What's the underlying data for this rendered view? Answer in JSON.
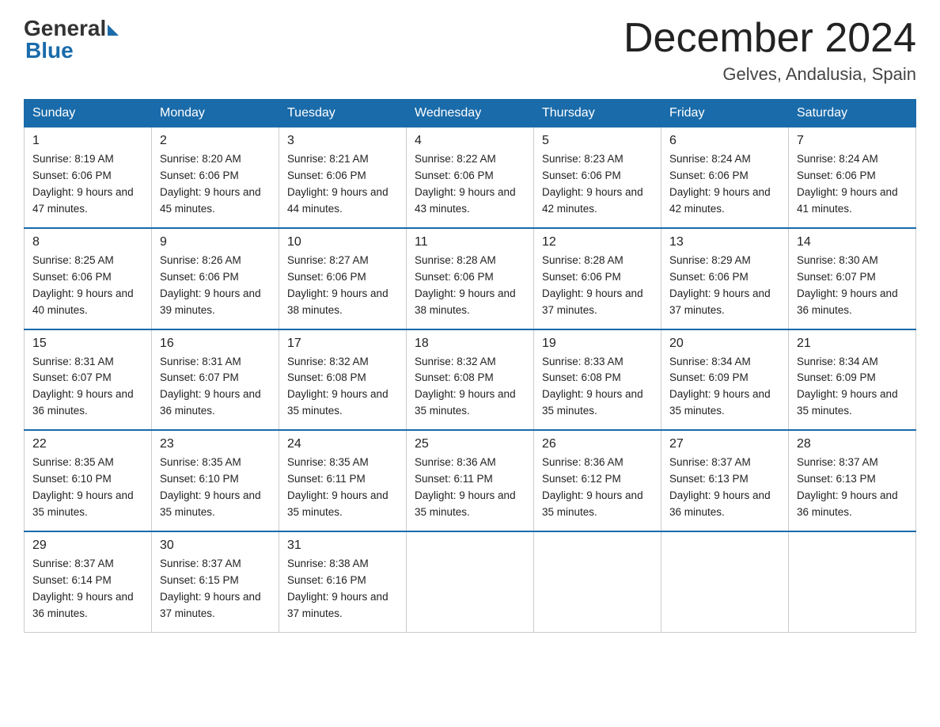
{
  "header": {
    "logo_general": "General",
    "logo_blue": "Blue",
    "month_title": "December 2024",
    "location": "Gelves, Andalusia, Spain"
  },
  "days_of_week": [
    "Sunday",
    "Monday",
    "Tuesday",
    "Wednesday",
    "Thursday",
    "Friday",
    "Saturday"
  ],
  "weeks": [
    [
      {
        "day": "1",
        "sunrise": "8:19 AM",
        "sunset": "6:06 PM",
        "daylight": "9 hours and 47 minutes."
      },
      {
        "day": "2",
        "sunrise": "8:20 AM",
        "sunset": "6:06 PM",
        "daylight": "9 hours and 45 minutes."
      },
      {
        "day": "3",
        "sunrise": "8:21 AM",
        "sunset": "6:06 PM",
        "daylight": "9 hours and 44 minutes."
      },
      {
        "day": "4",
        "sunrise": "8:22 AM",
        "sunset": "6:06 PM",
        "daylight": "9 hours and 43 minutes."
      },
      {
        "day": "5",
        "sunrise": "8:23 AM",
        "sunset": "6:06 PM",
        "daylight": "9 hours and 42 minutes."
      },
      {
        "day": "6",
        "sunrise": "8:24 AM",
        "sunset": "6:06 PM",
        "daylight": "9 hours and 42 minutes."
      },
      {
        "day": "7",
        "sunrise": "8:24 AM",
        "sunset": "6:06 PM",
        "daylight": "9 hours and 41 minutes."
      }
    ],
    [
      {
        "day": "8",
        "sunrise": "8:25 AM",
        "sunset": "6:06 PM",
        "daylight": "9 hours and 40 minutes."
      },
      {
        "day": "9",
        "sunrise": "8:26 AM",
        "sunset": "6:06 PM",
        "daylight": "9 hours and 39 minutes."
      },
      {
        "day": "10",
        "sunrise": "8:27 AM",
        "sunset": "6:06 PM",
        "daylight": "9 hours and 38 minutes."
      },
      {
        "day": "11",
        "sunrise": "8:28 AM",
        "sunset": "6:06 PM",
        "daylight": "9 hours and 38 minutes."
      },
      {
        "day": "12",
        "sunrise": "8:28 AM",
        "sunset": "6:06 PM",
        "daylight": "9 hours and 37 minutes."
      },
      {
        "day": "13",
        "sunrise": "8:29 AM",
        "sunset": "6:06 PM",
        "daylight": "9 hours and 37 minutes."
      },
      {
        "day": "14",
        "sunrise": "8:30 AM",
        "sunset": "6:07 PM",
        "daylight": "9 hours and 36 minutes."
      }
    ],
    [
      {
        "day": "15",
        "sunrise": "8:31 AM",
        "sunset": "6:07 PM",
        "daylight": "9 hours and 36 minutes."
      },
      {
        "day": "16",
        "sunrise": "8:31 AM",
        "sunset": "6:07 PM",
        "daylight": "9 hours and 36 minutes."
      },
      {
        "day": "17",
        "sunrise": "8:32 AM",
        "sunset": "6:08 PM",
        "daylight": "9 hours and 35 minutes."
      },
      {
        "day": "18",
        "sunrise": "8:32 AM",
        "sunset": "6:08 PM",
        "daylight": "9 hours and 35 minutes."
      },
      {
        "day": "19",
        "sunrise": "8:33 AM",
        "sunset": "6:08 PM",
        "daylight": "9 hours and 35 minutes."
      },
      {
        "day": "20",
        "sunrise": "8:34 AM",
        "sunset": "6:09 PM",
        "daylight": "9 hours and 35 minutes."
      },
      {
        "day": "21",
        "sunrise": "8:34 AM",
        "sunset": "6:09 PM",
        "daylight": "9 hours and 35 minutes."
      }
    ],
    [
      {
        "day": "22",
        "sunrise": "8:35 AM",
        "sunset": "6:10 PM",
        "daylight": "9 hours and 35 minutes."
      },
      {
        "day": "23",
        "sunrise": "8:35 AM",
        "sunset": "6:10 PM",
        "daylight": "9 hours and 35 minutes."
      },
      {
        "day": "24",
        "sunrise": "8:35 AM",
        "sunset": "6:11 PM",
        "daylight": "9 hours and 35 minutes."
      },
      {
        "day": "25",
        "sunrise": "8:36 AM",
        "sunset": "6:11 PM",
        "daylight": "9 hours and 35 minutes."
      },
      {
        "day": "26",
        "sunrise": "8:36 AM",
        "sunset": "6:12 PM",
        "daylight": "9 hours and 35 minutes."
      },
      {
        "day": "27",
        "sunrise": "8:37 AM",
        "sunset": "6:13 PM",
        "daylight": "9 hours and 36 minutes."
      },
      {
        "day": "28",
        "sunrise": "8:37 AM",
        "sunset": "6:13 PM",
        "daylight": "9 hours and 36 minutes."
      }
    ],
    [
      {
        "day": "29",
        "sunrise": "8:37 AM",
        "sunset": "6:14 PM",
        "daylight": "9 hours and 36 minutes."
      },
      {
        "day": "30",
        "sunrise": "8:37 AM",
        "sunset": "6:15 PM",
        "daylight": "9 hours and 37 minutes."
      },
      {
        "day": "31",
        "sunrise": "8:38 AM",
        "sunset": "6:16 PM",
        "daylight": "9 hours and 37 minutes."
      },
      null,
      null,
      null,
      null
    ]
  ]
}
